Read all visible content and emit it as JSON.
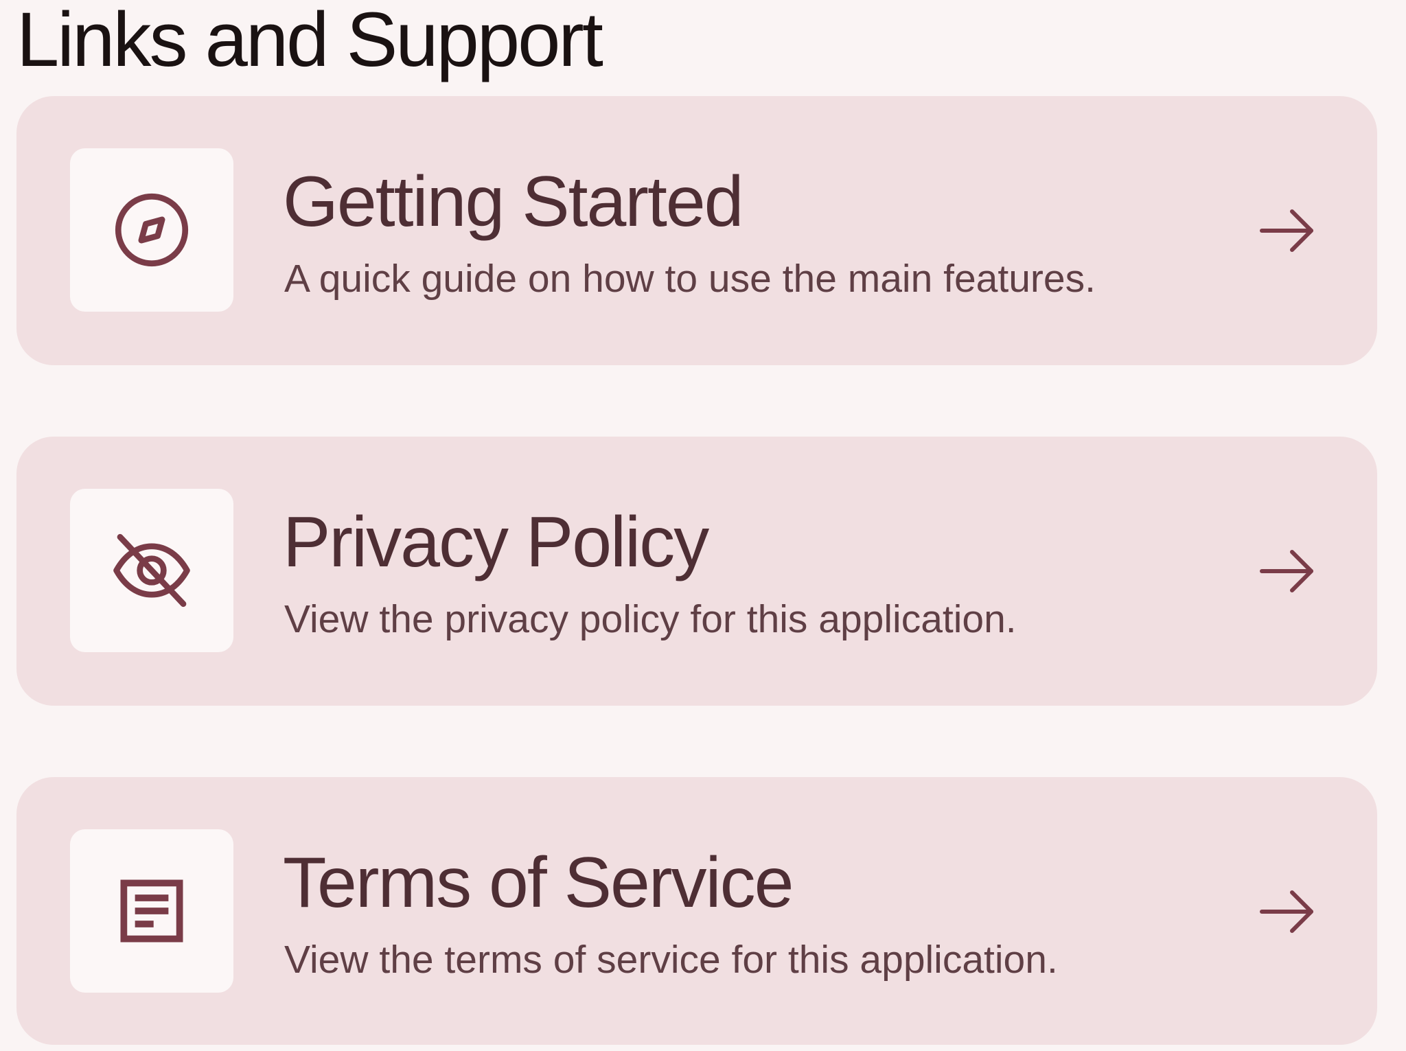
{
  "section": {
    "title": "Links and Support"
  },
  "colors": {
    "background": "#faf4f4",
    "card": "#f1dfe1",
    "icon_box": "#fcf7f7",
    "accent": "#7a3c48",
    "title_text": "#4e2e34",
    "heading_text": "#1a1212"
  },
  "links": [
    {
      "title": "Getting Started",
      "description": "A quick guide on how to use the main features.",
      "icon": "compass-icon",
      "action_icon": "arrow-right-icon"
    },
    {
      "title": "Privacy Policy",
      "description": "View the privacy policy for this application.",
      "icon": "eye-off-icon",
      "action_icon": "arrow-right-icon"
    },
    {
      "title": "Terms of Service",
      "description": "View the terms of service for this application.",
      "icon": "document-icon",
      "action_icon": "arrow-right-icon"
    }
  ]
}
